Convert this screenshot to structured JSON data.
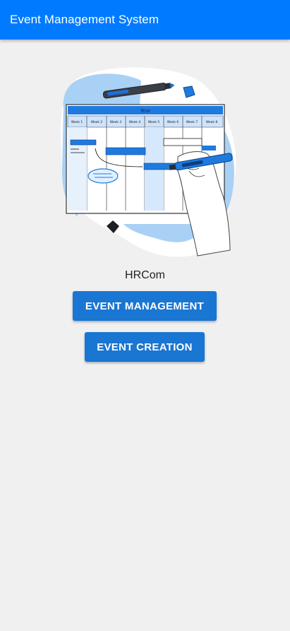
{
  "app_bar": {
    "title": "Event Management System",
    "color": "#007bff"
  },
  "illustration": {
    "header_label": "Year",
    "week_labels": [
      "Week 1",
      "Week 2",
      "Week 3",
      "Week 4",
      "Week 5",
      "Week 6",
      "Week 7",
      "Week 8"
    ]
  },
  "main": {
    "company_name": "HRCom",
    "buttons": {
      "event_management": "EVENT MANAGEMENT",
      "event_creation": "EVENT CREATION"
    },
    "button_color": "#1976d2"
  }
}
